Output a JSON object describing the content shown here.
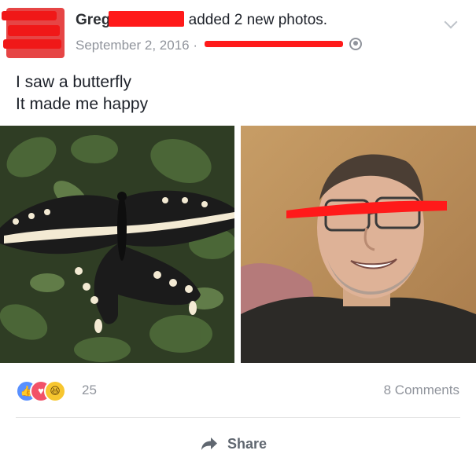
{
  "post": {
    "author": "Greg",
    "action": "added 2 new photos.",
    "date": "September 2, 2016",
    "separator": "·",
    "text_lines": [
      "I saw a butterfly",
      "It made me happy"
    ],
    "photos": [
      {
        "description": "black and white swallowtail butterfly on leaves"
      },
      {
        "description": "smiling man selfie"
      }
    ]
  },
  "footer": {
    "reactions": {
      "like": "👍",
      "love": "♥",
      "haha": "😆",
      "count": "25"
    },
    "comments_label": "8 Comments",
    "share_label": "Share"
  },
  "icons": {
    "privacy": "globe-icon",
    "menu": "chevron-down-icon",
    "share": "share-arrow-icon"
  },
  "colors": {
    "redaction": "#ff1a1a",
    "meta_text": "#90949c",
    "like": "#5890ff",
    "love": "#f25268",
    "haha": "#f7c62f"
  }
}
